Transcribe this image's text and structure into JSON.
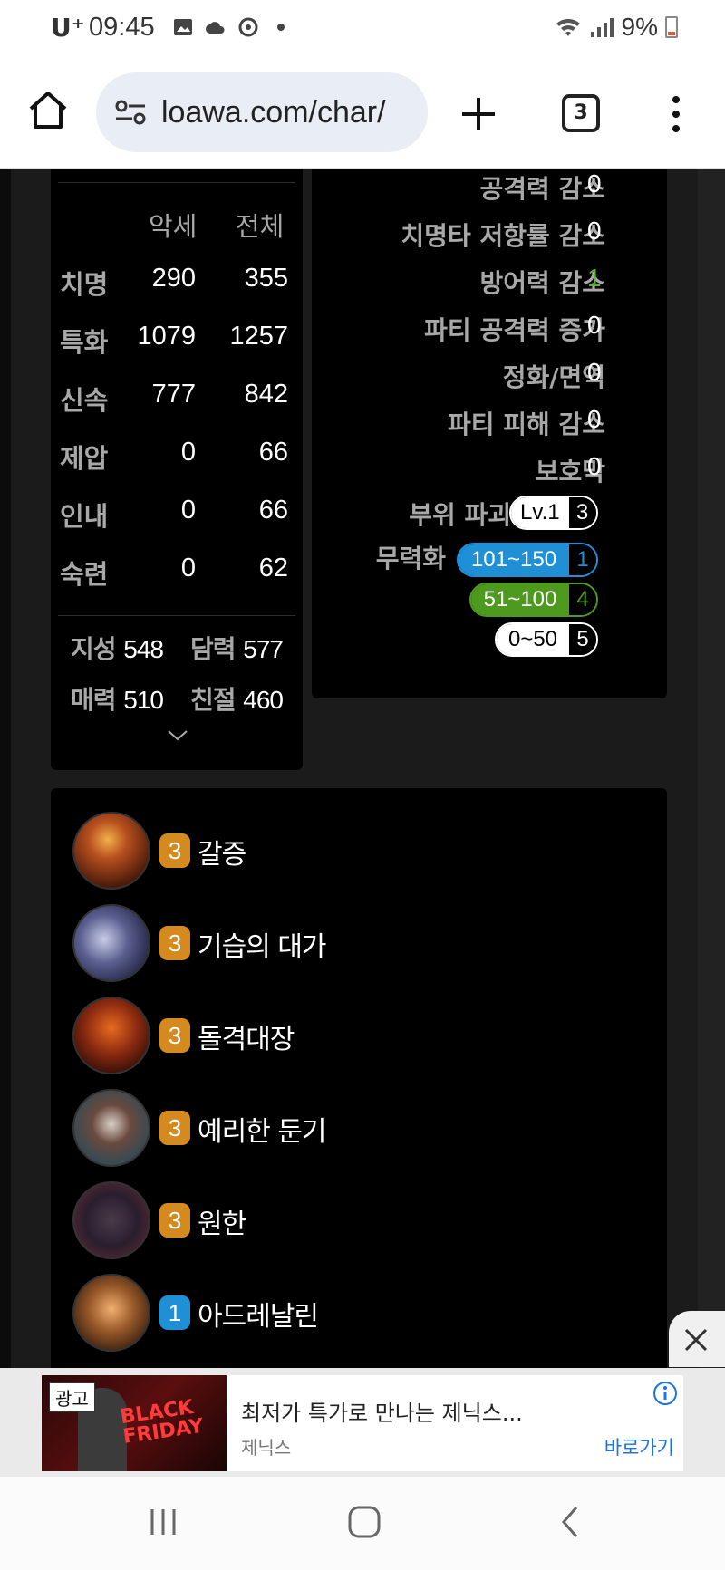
{
  "status_bar": {
    "carrier": "U⁺",
    "time": "09:45",
    "battery": "9%",
    "icons": [
      "gallery-icon",
      "cloud-icon",
      "sync-icon",
      "dot-icon",
      "wifi-icon",
      "signal-icon",
      "battery-icon"
    ]
  },
  "browser": {
    "url": "loawa.com/char/",
    "tab_count": "3"
  },
  "stats": {
    "header_equip": "악세",
    "header_total": "전체",
    "rows": [
      {
        "label": "치명",
        "accessory": "290",
        "total": "355"
      },
      {
        "label": "특화",
        "accessory": "1079",
        "total": "1257"
      },
      {
        "label": "신속",
        "accessory": "777",
        "total": "842"
      },
      {
        "label": "제압",
        "accessory": "0",
        "total": "66"
      },
      {
        "label": "인내",
        "accessory": "0",
        "total": "66"
      },
      {
        "label": "숙련",
        "accessory": "0",
        "total": "62"
      }
    ],
    "base": [
      {
        "label": "지성",
        "value": "548"
      },
      {
        "label": "담력",
        "value": "577"
      },
      {
        "label": "매력",
        "value": "510"
      },
      {
        "label": "친절",
        "value": "460"
      }
    ]
  },
  "effects": {
    "rows": [
      {
        "label": "공격력 감소",
        "value": "0"
      },
      {
        "label": "치명타 저항률 감소",
        "value": "0"
      },
      {
        "label": "방어력 감소",
        "value": "1"
      },
      {
        "label": "파티 공격력 증가",
        "value": "0"
      },
      {
        "label": "정화/면역",
        "value": "0"
      },
      {
        "label": "파티 피해 감소",
        "value": "0"
      },
      {
        "label": "보호막",
        "value": "0"
      }
    ],
    "part_break": {
      "label": "부위 파괴",
      "level": "Lv.1",
      "count": "3"
    },
    "stagger": {
      "label": "무력화",
      "tiers": [
        {
          "range": "101~150",
          "count": "1",
          "color": "#1f8fd6"
        },
        {
          "range": "51~100",
          "count": "4",
          "color": "#4e9a1e"
        },
        {
          "range": "0~50",
          "count": "5",
          "color": "#ffffff"
        }
      ]
    }
  },
  "engravings": [
    {
      "level": "3",
      "name": "갈증"
    },
    {
      "level": "3",
      "name": "기습의 대가"
    },
    {
      "level": "3",
      "name": "돌격대장"
    },
    {
      "level": "3",
      "name": "예리한 둔기"
    },
    {
      "level": "3",
      "name": "원한"
    },
    {
      "level": "1",
      "name": "아드레날린"
    }
  ],
  "ad": {
    "tag": "광고",
    "image_text": "BLACK FRIDAY",
    "title": "최저가 특가로 만나는 제닉스...",
    "source": "제닉스",
    "cta": "바로가기"
  },
  "colors": {
    "orange_badge": "#d48a1e",
    "blue_badge": "#1f8fd6",
    "green_value": "#5bb42a"
  }
}
